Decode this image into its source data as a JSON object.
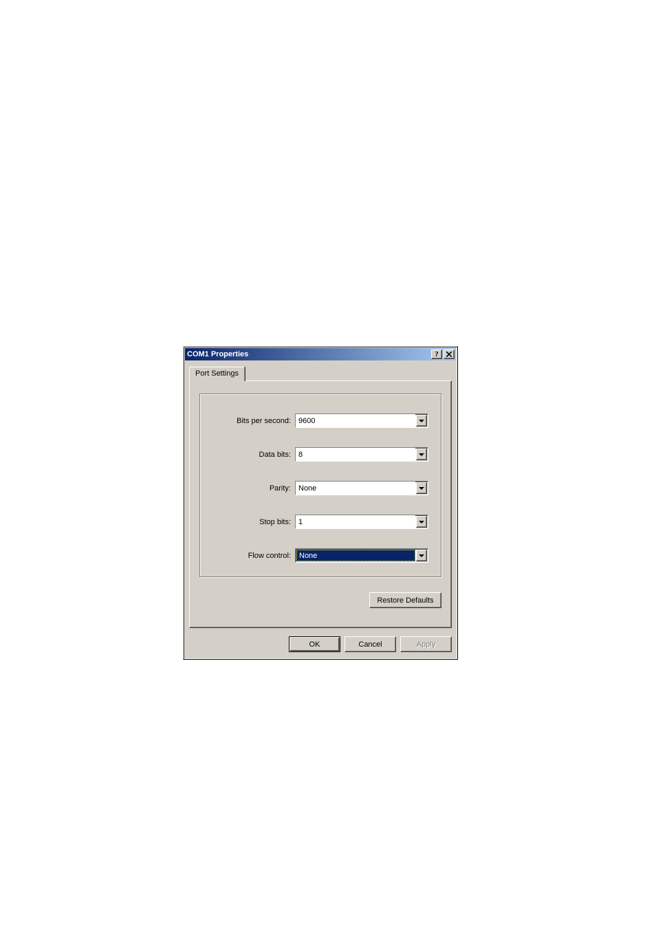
{
  "titlebar": {
    "title": "COM1 Properties"
  },
  "tab": {
    "label": "Port Settings"
  },
  "fields": {
    "bits_per_second": {
      "label": "Bits per second:",
      "value": "9600"
    },
    "data_bits": {
      "label": "Data bits:",
      "value": "8"
    },
    "parity": {
      "label": "Parity:",
      "value": "None"
    },
    "stop_bits": {
      "label": "Stop bits:",
      "value": "1"
    },
    "flow_control": {
      "label": "Flow control:",
      "value": "None"
    }
  },
  "buttons": {
    "restore": "Restore Defaults",
    "ok": "OK",
    "cancel": "Cancel",
    "apply": "Apply"
  }
}
